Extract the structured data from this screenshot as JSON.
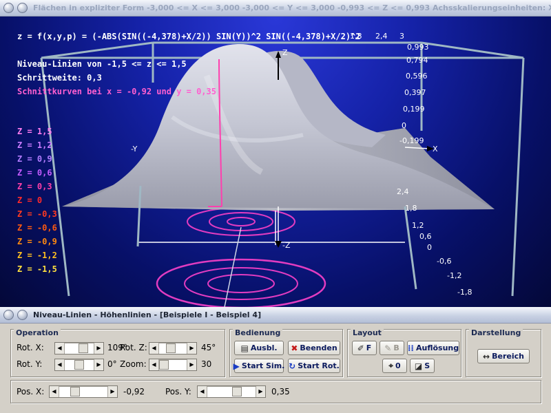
{
  "window_title": "Flächen in expliziter Form   -3,000 <= X <= 3,000   -3,000 <= Y <= 3,000   -0,993 <= Z <= 0,993   Achsskalierungseinheiten:  X: 0,300 LE    Y: 0,...",
  "panel_title": "Niveau-Linien - Höhenlinien - [Beispiele I - Beispiel 4]",
  "viewport": {
    "formula": "z = f(x,y,p) = (-ABS(SIN((-4,378)+X/2)) SIN(Y))^2 SIN((-4,378)+X/2)^2",
    "level_range": "Niveau-Linien von -1,5 <= z <= 1,5",
    "step": "Schrittweite: 0,3",
    "cut_curves": "Schnittkurven bei x = -0,92 und y = 0,35",
    "z_levels": [
      "Z = 1,5",
      "Z = 1,2",
      "Z = 0,9",
      "Z = 0,6",
      "Z = 0,3",
      "Z = 0",
      "Z = -0,3",
      "Z = -0,6",
      "Z = -0,9",
      "Z = -1,2",
      "Z = -1,5"
    ],
    "z_level_colors": [
      "#ff7cf0",
      "#c97bff",
      "#b27cff",
      "#c45cff",
      "#ff3fa8",
      "#ff2a2a",
      "#ff3a20",
      "#ff5a10",
      "#ff8a10",
      "#ffc020",
      "#ffe040"
    ],
    "axis_labels": {
      "z_top": "Z",
      "z_bottom": "-Z",
      "x": "X",
      "y": "-Y"
    },
    "x_ticks": [
      "1,8",
      "2,4",
      "3"
    ],
    "z_ticks": [
      "0,993",
      "0,794",
      "0,596",
      "0,397",
      "0,199",
      "0",
      "-0,199"
    ],
    "y_ticks": [
      "2,4",
      "1,8",
      "1,2",
      "0,6",
      "0",
      "-0,6",
      "-1,2",
      "-1,8"
    ],
    "colors": {
      "surface": "#c8cad6",
      "contour_magenta": "#e23cc0",
      "contour_pink": "#ff7ad8",
      "frame": "#9fb8c4"
    }
  },
  "operation": {
    "title": "Operation",
    "rot_x_label": "Rot. X:",
    "rot_x_value": "109°",
    "rot_z_label": "Rot. Z:",
    "rot_z_value": "45°",
    "rot_y_label": "Rot. Y:",
    "rot_y_value": "0°",
    "zoom_label": "Zoom:",
    "zoom_value": "30"
  },
  "bedienung": {
    "title": "Bedienung",
    "ausbl": "Ausbl.",
    "beenden": "Beenden",
    "start_sim": "Start Sim.",
    "start_rot": "Start Rot."
  },
  "layout": {
    "title": "Layout",
    "f_btn": "F",
    "b_btn": "B",
    "aufloesung": "Auflösung",
    "zero_btn": "0",
    "s_btn": "S"
  },
  "darstellung": {
    "title": "Darstellung",
    "bereich": "Bereich"
  },
  "position": {
    "pos_x_label": "Pos. X:",
    "pos_x_value": "-0,92",
    "pos_y_label": "Pos. Y:",
    "pos_y_value": "0,35"
  },
  "icons": {
    "window": [
      "minimize-icon",
      "maximize-icon"
    ],
    "buttons": [
      "hide-icon",
      "close-icon",
      "play-icon",
      "rotate-icon",
      "pen-icon",
      "brush-icon",
      "resolution-icon",
      "crosshair-icon",
      "fill-icon",
      "range-icon"
    ]
  }
}
